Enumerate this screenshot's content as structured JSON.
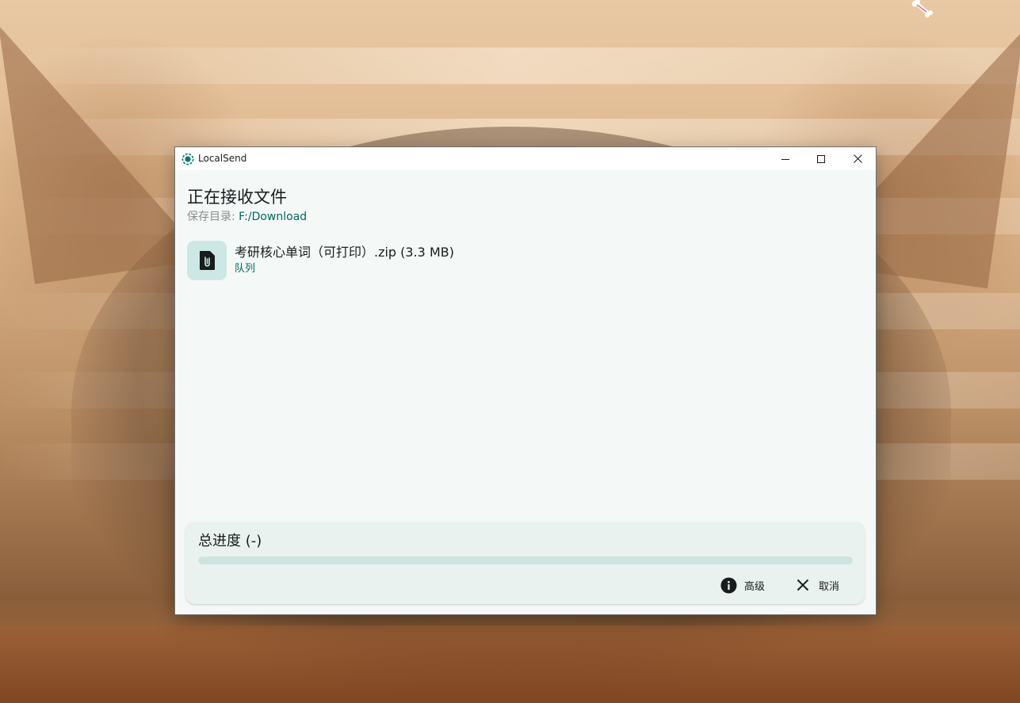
{
  "window": {
    "title": "LocalSend",
    "controls": {
      "minimize_icon": "minimize-icon",
      "maximize_icon": "maximize-icon",
      "close_icon": "close-icon"
    }
  },
  "receive": {
    "heading": "正在接收文件",
    "save_dir_label": "保存目录:",
    "save_dir_path": "F:/Download"
  },
  "files": [
    {
      "icon": "file-attachment-icon",
      "name": "考研核心单词（可打印）.zip (3.3 MB)",
      "status": "队列"
    }
  ],
  "progress": {
    "title": "总进度 (-)",
    "fraction": 0,
    "advanced_label": "高级",
    "advanced_icon": "info-icon",
    "cancel_label": "取消",
    "cancel_icon": "close-icon"
  },
  "colors": {
    "accent": "#00685f",
    "window_background": "#f4f9f8",
    "file_icon_background": "#cde8e4",
    "progress_track": "#cde5e1",
    "card_background": "#eaf2f0"
  }
}
